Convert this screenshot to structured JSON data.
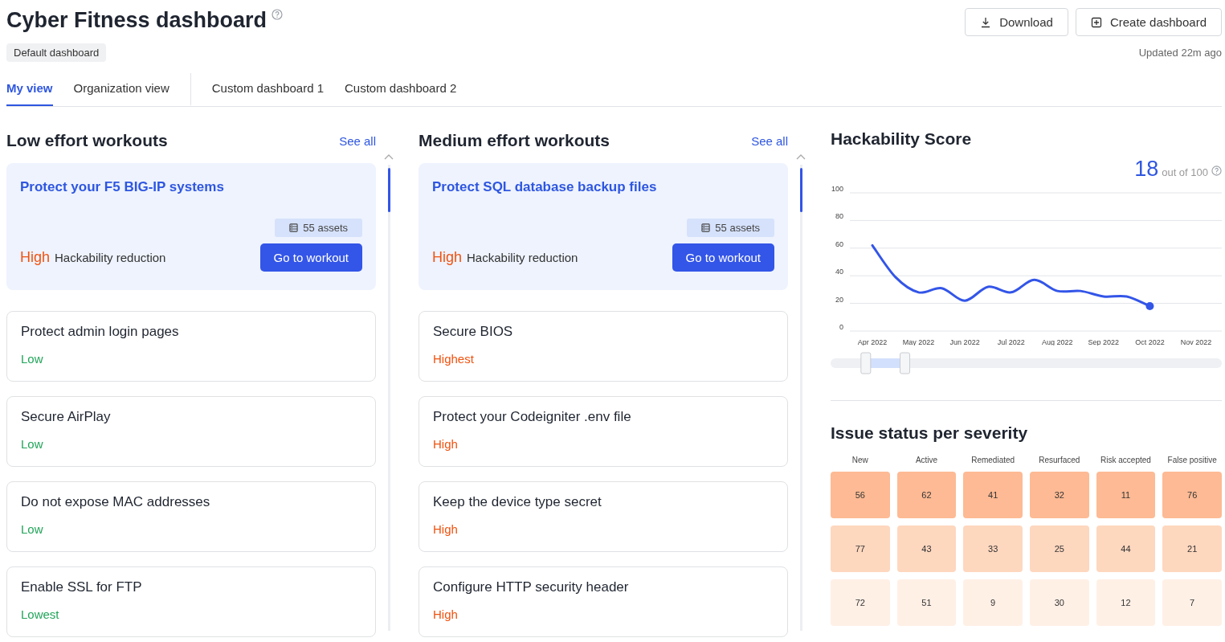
{
  "header": {
    "title": "Cyber Fitness dashboard",
    "badge": "Default dashboard",
    "buttons": [
      {
        "label": "Download",
        "kind": "download"
      },
      {
        "label": "Create dashboard",
        "kind": "create"
      }
    ],
    "updated": "Updated 22m ago"
  },
  "tabs": [
    {
      "label": "My view",
      "selected": true,
      "divider_before": false
    },
    {
      "label": "Organization view",
      "selected": false,
      "divider_before": false
    },
    {
      "label": "Custom dashboard 1",
      "selected": false,
      "divider_before": true
    },
    {
      "label": "Custom dashboard 2",
      "selected": false,
      "divider_before": false
    }
  ],
  "columns": [
    {
      "title": "Low effort workouts",
      "see_all": "See all",
      "items": [
        {
          "kind": "featured",
          "title": "Protect your F5 BIG-IP systems",
          "assets": "55 assets",
          "rating": "High",
          "color": "#f0520f",
          "reduction": "Hackability reduction",
          "action": "Go to workout"
        },
        {
          "kind": "plain",
          "title": "Protect admin login pages",
          "rating": "Low",
          "color": "#22a55a"
        },
        {
          "kind": "plain",
          "title": "Secure AirPlay",
          "rating": "Low",
          "color": "#22a55a"
        },
        {
          "kind": "plain",
          "title": "Do not expose MAC addresses",
          "rating": "Low",
          "color": "#22a55a"
        },
        {
          "kind": "plain",
          "title": "Enable SSL for FTP",
          "rating": "Lowest",
          "color": "#22a55a"
        }
      ]
    },
    {
      "title": "Medium effort workouts",
      "see_all": "See all",
      "items": [
        {
          "kind": "featured",
          "title": "Protect SQL database backup files",
          "assets": "55 assets",
          "rating": "High",
          "color": "#f0520f",
          "reduction": "Hackability reduction",
          "action": "Go to workout"
        },
        {
          "kind": "plain",
          "title": "Secure BIOS",
          "rating": "Highest",
          "color": "#f0520f"
        },
        {
          "kind": "plain",
          "title": "Protect your Codeigniter .env file",
          "rating": "High",
          "color": "#f0520f"
        },
        {
          "kind": "plain",
          "title": "Keep the device type secret",
          "rating": "High",
          "color": "#f0520f"
        },
        {
          "kind": "plain",
          "title": "Configure HTTP security header",
          "rating": "High",
          "color": "#f0520f"
        }
      ]
    }
  ],
  "hackability": {
    "title": "Hackability Score",
    "score": "18",
    "out_of": "out of 100",
    "chart_data": {
      "type": "line",
      "categories": [
        "Apr 2022",
        null,
        "May 2022",
        null,
        "Jun 2022",
        null,
        "Jul 2022",
        null,
        "Aug 2022",
        null,
        "Sep 2022",
        null,
        "Oct 2022",
        null,
        "Nov 2022"
      ],
      "series": [
        {
          "color": "#3355e8",
          "values": [
            62,
            39,
            28,
            31,
            22,
            32,
            28,
            37,
            29,
            29,
            25,
            25,
            18,
            null,
            null
          ]
        }
      ],
      "ylim": [
        0,
        100
      ],
      "grid": true,
      "yticks": [
        0,
        20,
        40,
        60,
        80,
        100
      ]
    }
  },
  "range_slider": [
    {
      "level": 0.09
    },
    {
      "level": 0.19
    }
  ],
  "issues": {
    "title": "Issue status per severity",
    "columns": [
      "New",
      "Active",
      "Remediated",
      "Resurfaced",
      "Risk accepted",
      "False positive"
    ],
    "rows": [
      {
        "color": "#fdba94",
        "values": [
          "56",
          "62",
          "41",
          "32",
          "11",
          "76"
        ]
      },
      {
        "color": "#fed7bf",
        "values": [
          "77",
          "43",
          "33",
          "25",
          "44",
          "21"
        ]
      },
      {
        "color": "#fff0e6",
        "values": [
          "72",
          "51",
          "9",
          "30",
          "12",
          "7"
        ]
      }
    ]
  }
}
